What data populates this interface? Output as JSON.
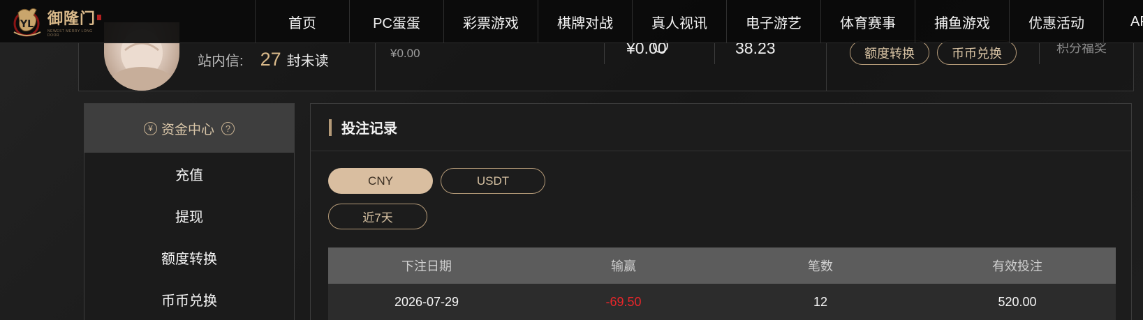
{
  "brand": {
    "name": "御隆门",
    "sub": "NEWEST MERRY LONG DOOR"
  },
  "nav": {
    "items": [
      {
        "label": "首页"
      },
      {
        "label": "PC蛋蛋"
      },
      {
        "label": "彩票游戏"
      },
      {
        "label": "棋牌对战"
      },
      {
        "label": "真人视讯"
      },
      {
        "label": "电子游艺"
      },
      {
        "label": "体育赛事"
      },
      {
        "label": "捕鱼游戏"
      },
      {
        "label": "优惠活动"
      },
      {
        "label": "APP"
      }
    ]
  },
  "account": {
    "message_label": "站内信:",
    "message_count": "27",
    "message_suffix": "封未读",
    "wallet_small": "¥0.00",
    "balance_1": "¥0.00",
    "balance_2": "38.23",
    "transfer_button": "额度转换",
    "exchange_button": "币币兑换",
    "points_label": "积分福奖"
  },
  "sidebar": {
    "header": "资金中心",
    "yen_glyph": "¥",
    "help_glyph": "?",
    "items": [
      {
        "label": "充值"
      },
      {
        "label": "提现"
      },
      {
        "label": "额度转换"
      },
      {
        "label": "币币兑换"
      }
    ]
  },
  "main": {
    "title": "投注记录",
    "currency_tabs": [
      {
        "label": "CNY",
        "active": true
      },
      {
        "label": "USDT",
        "active": false
      }
    ],
    "range_tab": "近7天",
    "table": {
      "columns": [
        "下注日期",
        "输赢",
        "笔数",
        "有效投注"
      ],
      "rows": [
        {
          "date": "2026-07-29",
          "win_loss": "-69.50",
          "count": "12",
          "valid_bet": "520.00"
        }
      ]
    }
  },
  "colors": {
    "accent": "#b49a78",
    "accent_fill": "#d9bea0",
    "loss": "#e8262a"
  }
}
